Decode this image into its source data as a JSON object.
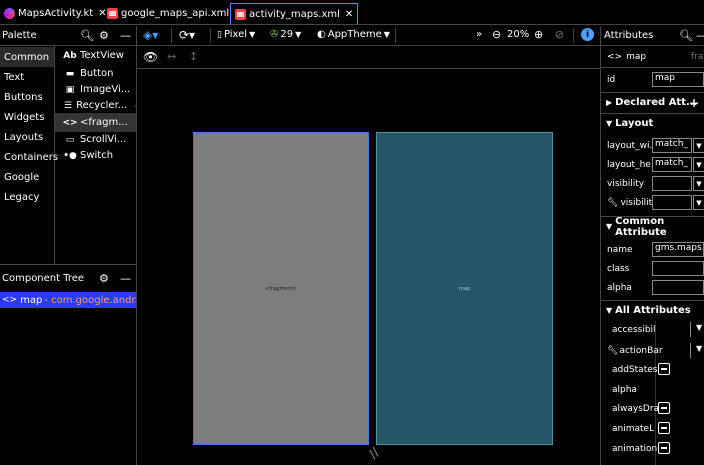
{
  "tabs": [
    {
      "label": "MapsActivity.kt",
      "icon": "kotlin-file-icon",
      "active": false
    },
    {
      "label": "google_maps_api.xml",
      "icon": "xml-file-icon",
      "active": false
    },
    {
      "label": "activity_maps.xml",
      "icon": "xml-file-icon",
      "active": true
    }
  ],
  "palette": {
    "title": "Palette",
    "categories": [
      "Common",
      "Text",
      "Buttons",
      "Widgets",
      "Layouts",
      "Containers",
      "Google",
      "Legacy"
    ],
    "selected_category": "Common",
    "items": [
      {
        "label": "TextView",
        "glyph": "Ab"
      },
      {
        "label": "Button",
        "glyph": "▬"
      },
      {
        "label": "ImageVi...",
        "glyph": "▣"
      },
      {
        "label": "Recycler...",
        "glyph": "☰"
      },
      {
        "label": "<fragm...",
        "glyph": "<>"
      },
      {
        "label": "ScrollVi...",
        "glyph": "▭"
      },
      {
        "label": "Switch",
        "glyph": "•●"
      }
    ]
  },
  "component_tree": {
    "title": "Component Tree",
    "row_id": "map",
    "row_class": "- com.google.andr..."
  },
  "toolbar": {
    "device": "Pixel",
    "api": "29",
    "theme": "AppTheme",
    "zoom": "20%"
  },
  "canvas": {
    "design_label": "<fragment>",
    "blueprint_label": "map",
    "design_color": "#7d7d7d",
    "blueprint_color": "#255566"
  },
  "attributes": {
    "title": "Attributes",
    "selected_name": "map",
    "selected_class_abbr": "fra",
    "id_label": "id",
    "id_value": "map",
    "declared_section": "Declared Att...",
    "layout_section": "Layout",
    "layout_width_label": "layout_wi...",
    "layout_width_value": "match_",
    "layout_height_label": "layout_he...",
    "layout_height_value": "match_",
    "visibility_label": "visibility",
    "tools_visibility_label": "visibility",
    "common_section": "Common Attribute",
    "name_label": "name",
    "name_value": "gms.maps.S",
    "class_label": "class",
    "alpha_label": "alpha",
    "all_section": "All Attributes",
    "all_items": [
      "accessibil",
      "actionBar",
      "addStates",
      "alpha",
      "alwaysDra",
      "animateL",
      "animation"
    ]
  },
  "colors": {
    "accent": "#2a3bff",
    "tab_border": "#6b7bff",
    "panel_border": "#444444"
  }
}
